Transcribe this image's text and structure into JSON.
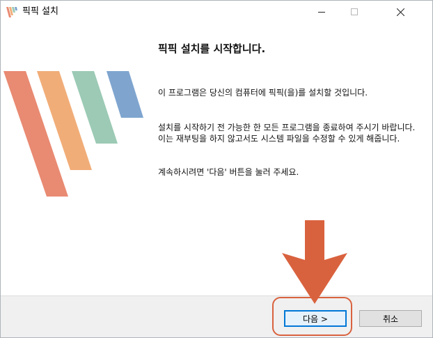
{
  "window": {
    "title": "픽픽 설치"
  },
  "welcome": {
    "heading": "픽픽 설치를 시작합니다.",
    "paragraph1": "이 프로그램은 당신의 컴퓨터에 픽픽(을)를 설치할 것입니다.",
    "paragraph2": "설치를 시작하기 전 가능한 한 모든 프로그램을 종료하여 주시기 바랍니다. 이는 재부팅을 하지 않고서도 시스템 파일을 수정할 수 있게 해줍니다.",
    "paragraph3": "계속하시려면 '다음' 버튼을 눌러 주세요."
  },
  "buttons": {
    "next": "다음 >",
    "cancel": "취소"
  },
  "colors": {
    "stripe_red": "#e98a72",
    "stripe_orange": "#f1ad78",
    "stripe_green": "#9ccab5",
    "stripe_blue": "#7fa5cf",
    "annotation": "#d9623e",
    "focus_border": "#0078d7"
  },
  "icons": {
    "app": "picpick-stripes-icon",
    "minimize": "minimize-icon",
    "maximize": "maximize-icon",
    "close": "close-icon",
    "annotation_arrow": "down-arrow-icon"
  }
}
